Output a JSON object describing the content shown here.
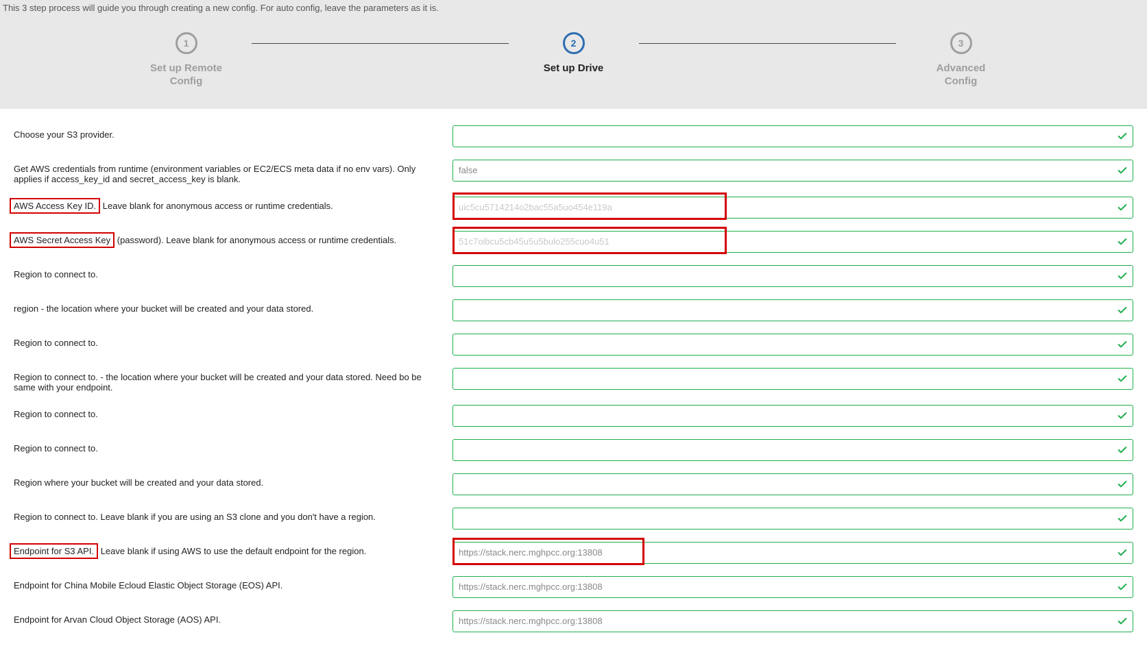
{
  "intro": "This 3 step process will guide you through creating a new config. For auto config, leave the parameters as it is.",
  "stepper": {
    "steps": [
      {
        "num": "1",
        "label": "Set up Remote\nConfig",
        "active": false
      },
      {
        "num": "2",
        "label": "Set up Drive",
        "active": true
      },
      {
        "num": "3",
        "label": "Advanced\nConfig",
        "active": false
      }
    ]
  },
  "form": {
    "rows": [
      {
        "label_head": "",
        "label_rest": "Choose your S3 provider.",
        "value": "",
        "highlight_label": false,
        "highlight_input": false,
        "redacted": false
      },
      {
        "label_head": "",
        "label_rest": "Get AWS credentials from runtime (environment variables or EC2/ECS meta data if no env vars). Only applies if access_key_id and secret_access_key is blank.",
        "value": "false",
        "highlight_label": false,
        "highlight_input": false,
        "redacted": false
      },
      {
        "label_head": "AWS Access Key ID.",
        "label_rest": " Leave blank for anonymous access or runtime credentials.",
        "value": "uic5cu5714214o2bac55a5uo454e119a",
        "highlight_label": true,
        "highlight_input": true,
        "redacted": true
      },
      {
        "label_head": "AWS Secret Access Key",
        "label_rest": " (password). Leave blank for anonymous access or runtime credentials.",
        "value": "51c7oibcu5cb45u5u5bulo255cuo4u51",
        "highlight_label": true,
        "highlight_input": true,
        "redacted": true
      },
      {
        "label_head": "",
        "label_rest": "Region to connect to.",
        "value": "",
        "highlight_label": false,
        "highlight_input": false,
        "redacted": false
      },
      {
        "label_head": "",
        "label_rest": "region - the location where your bucket will be created and your data stored.",
        "value": "",
        "highlight_label": false,
        "highlight_input": false,
        "redacted": false
      },
      {
        "label_head": "",
        "label_rest": "Region to connect to.",
        "value": "",
        "highlight_label": false,
        "highlight_input": false,
        "redacted": false
      },
      {
        "label_head": "",
        "label_rest": "Region to connect to. - the location where your bucket will be created and your data stored. Need bo be same with your endpoint.",
        "value": "",
        "highlight_label": false,
        "highlight_input": false,
        "redacted": false
      },
      {
        "label_head": "",
        "label_rest": "Region to connect to.",
        "value": "",
        "highlight_label": false,
        "highlight_input": false,
        "redacted": false
      },
      {
        "label_head": "",
        "label_rest": "Region to connect to.",
        "value": "",
        "highlight_label": false,
        "highlight_input": false,
        "redacted": false
      },
      {
        "label_head": "",
        "label_rest": "Region where your bucket will be created and your data stored.",
        "value": "",
        "highlight_label": false,
        "highlight_input": false,
        "redacted": false
      },
      {
        "label_head": "",
        "label_rest": "Region to connect to. Leave blank if you are using an S3 clone and you don't have a region.",
        "value": "",
        "highlight_label": false,
        "highlight_input": false,
        "redacted": false
      },
      {
        "label_head": "Endpoint for S3 API.",
        "label_rest": " Leave blank if using AWS to use the default endpoint for the region.",
        "value": "https://stack.nerc.mghpcc.org:13808",
        "highlight_label": true,
        "highlight_input": true,
        "redacted": false,
        "highlight_wider": true
      },
      {
        "label_head": "",
        "label_rest": "Endpoint for China Mobile Ecloud Elastic Object Storage (EOS) API.",
        "value": "https://stack.nerc.mghpcc.org:13808",
        "highlight_label": false,
        "highlight_input": false,
        "redacted": false
      },
      {
        "label_head": "",
        "label_rest": "Endpoint for Arvan Cloud Object Storage (AOS) API.",
        "value": "https://stack.nerc.mghpcc.org:13808",
        "highlight_label": false,
        "highlight_input": false,
        "redacted": false
      }
    ]
  }
}
